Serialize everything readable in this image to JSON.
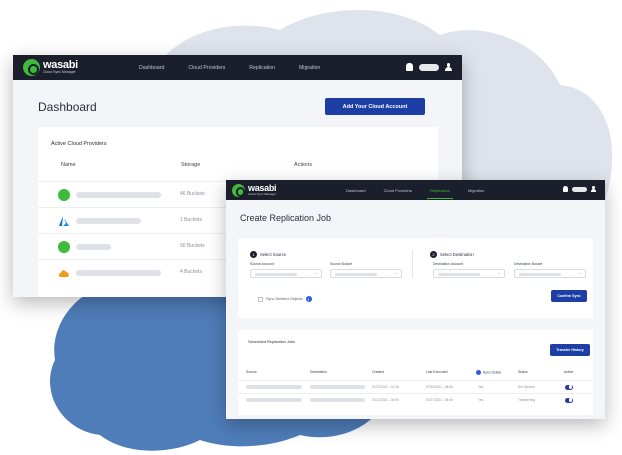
{
  "colors": {
    "cloud_light": "#dfe3ec",
    "cloud_blue": "#4f7db9",
    "topbar": "#1b1e2b",
    "accent_green": "#3fba3b",
    "primary_button": "#1d3fa5"
  },
  "dashboard": {
    "logo": {
      "word": "wasabi",
      "sub": "Cloud Sync Manager"
    },
    "nav": [
      "Dashboard",
      "Cloud Providers",
      "Replication",
      "Migration"
    ],
    "title": "Dashboard",
    "add_button": "Add Your Cloud Account",
    "card_title": "Active Cloud Providers",
    "columns": {
      "name": "Name",
      "storage": "Storage",
      "actions": "Actions"
    },
    "rows": [
      {
        "icon": "wasabi-icon",
        "storage": "46 Buckets"
      },
      {
        "icon": "azure-icon",
        "storage": "1 Buckets"
      },
      {
        "icon": "wasabi-icon",
        "storage": "90 Buckets"
      },
      {
        "icon": "cloud-provider-icon",
        "storage": "4 Buckets"
      }
    ]
  },
  "replication": {
    "logo": {
      "word": "wasabi",
      "sub": "Cloud Sync Manager"
    },
    "nav": [
      "Dashboard",
      "Cloud Providers",
      "Replication",
      "Migration"
    ],
    "active_nav": "Replication",
    "title": "Create Replication Job",
    "source": {
      "step": "1",
      "label": "Select Source",
      "account_label": "Source Account",
      "bucket_label": "Source Bucket"
    },
    "destination": {
      "step": "2",
      "label": "Select Destination",
      "account_label": "Destination Account",
      "bucket_label": "Destination Bucket"
    },
    "sync_label": "Sync Deleted Objects",
    "confirm_button": "Confirm Sync",
    "scheduled_title": "Scheduled Replication Jobs",
    "transfer_button": "Transfer History",
    "columns": [
      "Source",
      "Destination",
      "Created",
      "Last Executed",
      "Sync Delete",
      "Status",
      "Active"
    ],
    "jobs": [
      {
        "created": "07/27/2021 - 01:46",
        "last_executed": "07/30/2021 - 08:06",
        "sync_delete": "Yes",
        "status": "Not Synced"
      },
      {
        "created": "07/12/2021 - 04:09",
        "last_executed": "07/27/2021 - 06:46",
        "sync_delete": "Yes",
        "status": "Transferring"
      }
    ]
  }
}
